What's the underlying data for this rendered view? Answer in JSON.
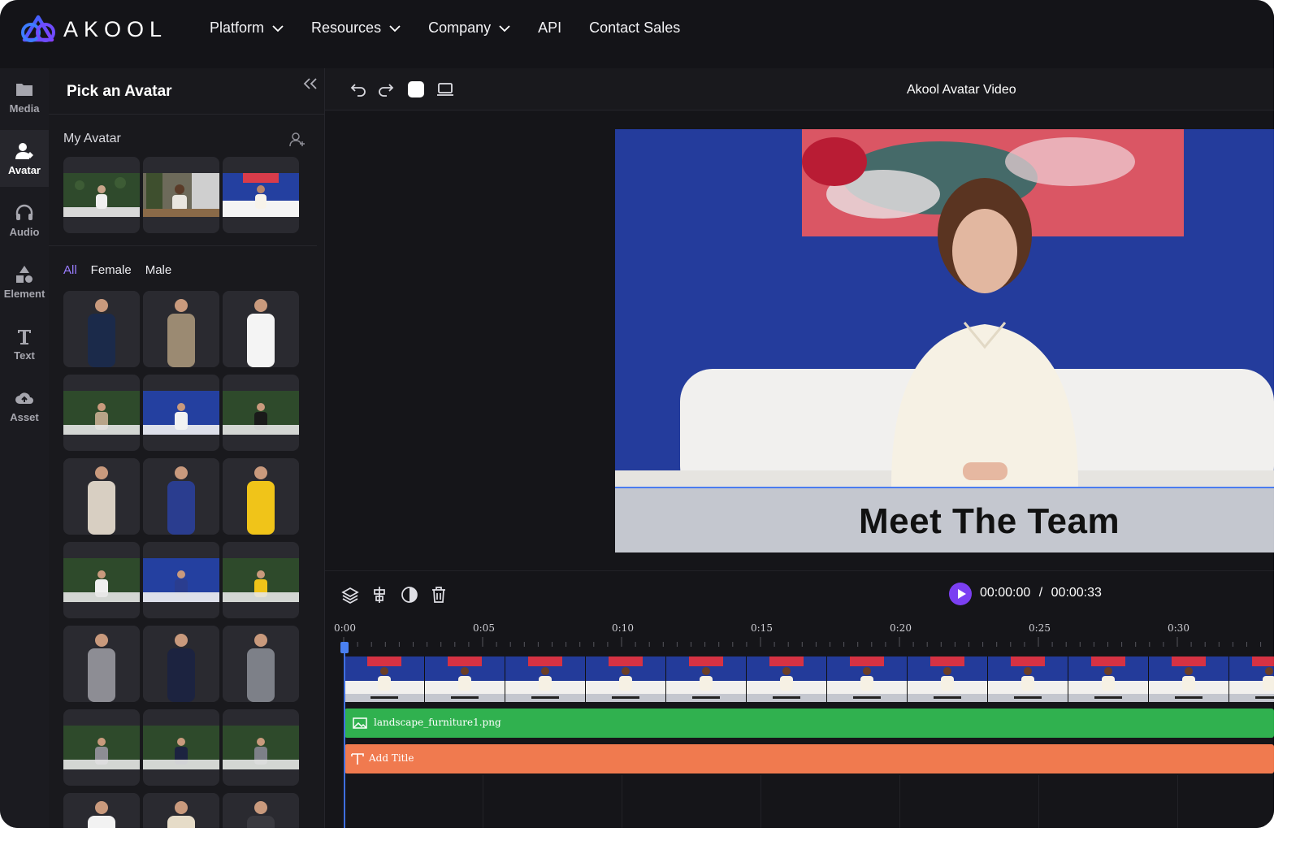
{
  "brand": {
    "name": "AKOOL"
  },
  "nav": {
    "items": [
      {
        "label": "Platform",
        "dropdown": true
      },
      {
        "label": "Resources",
        "dropdown": true
      },
      {
        "label": "Company",
        "dropdown": true
      },
      {
        "label": "API",
        "dropdown": false
      },
      {
        "label": "Contact Sales",
        "dropdown": false
      }
    ]
  },
  "rail": {
    "items": [
      {
        "label": "Media",
        "icon": "folder-icon",
        "active": false
      },
      {
        "label": "Avatar",
        "icon": "avatar-icon",
        "active": true
      },
      {
        "label": "Audio",
        "icon": "headphones-icon",
        "active": false
      },
      {
        "label": "Element",
        "icon": "shapes-icon",
        "active": false
      },
      {
        "label": "Text",
        "icon": "text-icon",
        "active": false
      },
      {
        "label": "Asset",
        "icon": "cloud-upload-icon",
        "active": false
      }
    ]
  },
  "panel": {
    "title": "Pick an Avatar",
    "my_avatar_label": "My Avatar",
    "filters": [
      {
        "label": "All",
        "active": true
      },
      {
        "label": "Female",
        "active": false
      },
      {
        "label": "Male",
        "active": false
      }
    ]
  },
  "editor": {
    "project_title": "Akool Avatar Video",
    "caption": "Meet The Team",
    "timecode_current": "00:00:00",
    "timecode_separator": "/",
    "timecode_total": "00:00:33",
    "ruler_labels": [
      "0:00",
      "0:05",
      "0:10",
      "0:15",
      "0:20",
      "0:25",
      "0:30"
    ],
    "tracks": {
      "image_label": "landscape_furniture1.png",
      "title_label": "Add Title"
    }
  },
  "colors": {
    "accent": "#7b3ff2",
    "image_track": "#30b14f",
    "title_track": "#f07a4f",
    "canvas_bg": "#233a98"
  }
}
